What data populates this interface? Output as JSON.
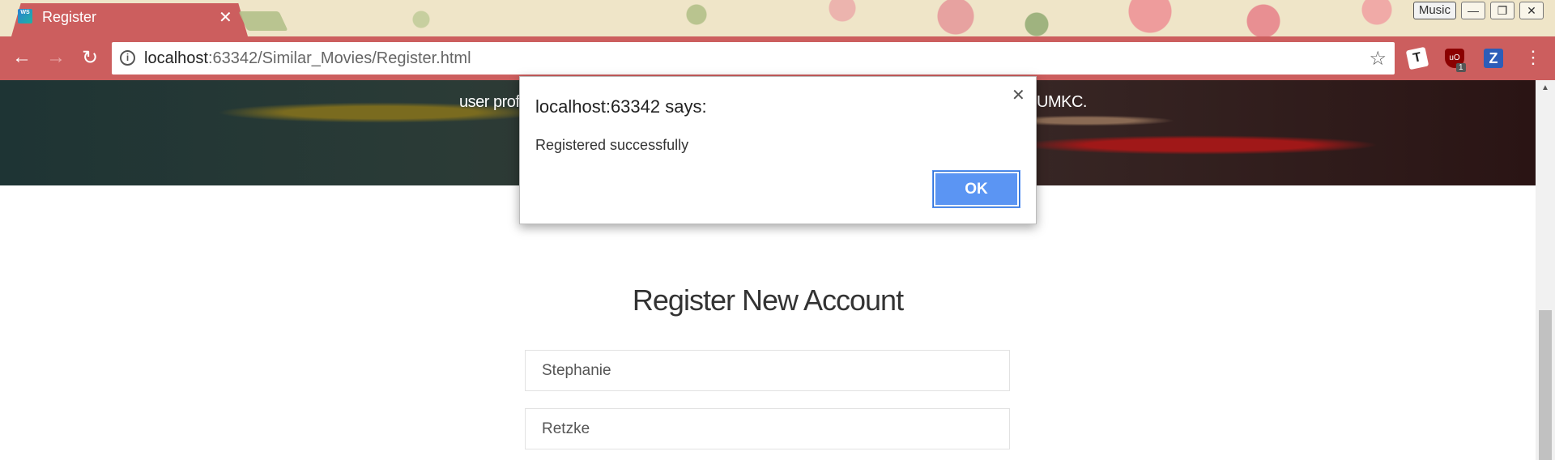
{
  "browser": {
    "tab_title": "Register",
    "favicon_text": "WS",
    "profile_label": "Music",
    "url_host": "localhost",
    "url_rest": ":63342/Similar_Movies/Register.html",
    "extension_badge": "1",
    "extension_ub_text": "uO",
    "extension_t_text": "T",
    "extension_z_text": "Z"
  },
  "page": {
    "hero_text_left": "user profi",
    "hero_text_right": "UMKC.",
    "form_title": "Register New Account",
    "fields": [
      {
        "value": "Stephanie"
      },
      {
        "value": "Retzke"
      }
    ]
  },
  "dialog": {
    "title": "localhost:63342 says:",
    "message": "Registered successfully",
    "ok_label": "OK"
  },
  "colors": {
    "tab_bar": "#cc5e5e",
    "ok_button": "#5b95f3"
  }
}
